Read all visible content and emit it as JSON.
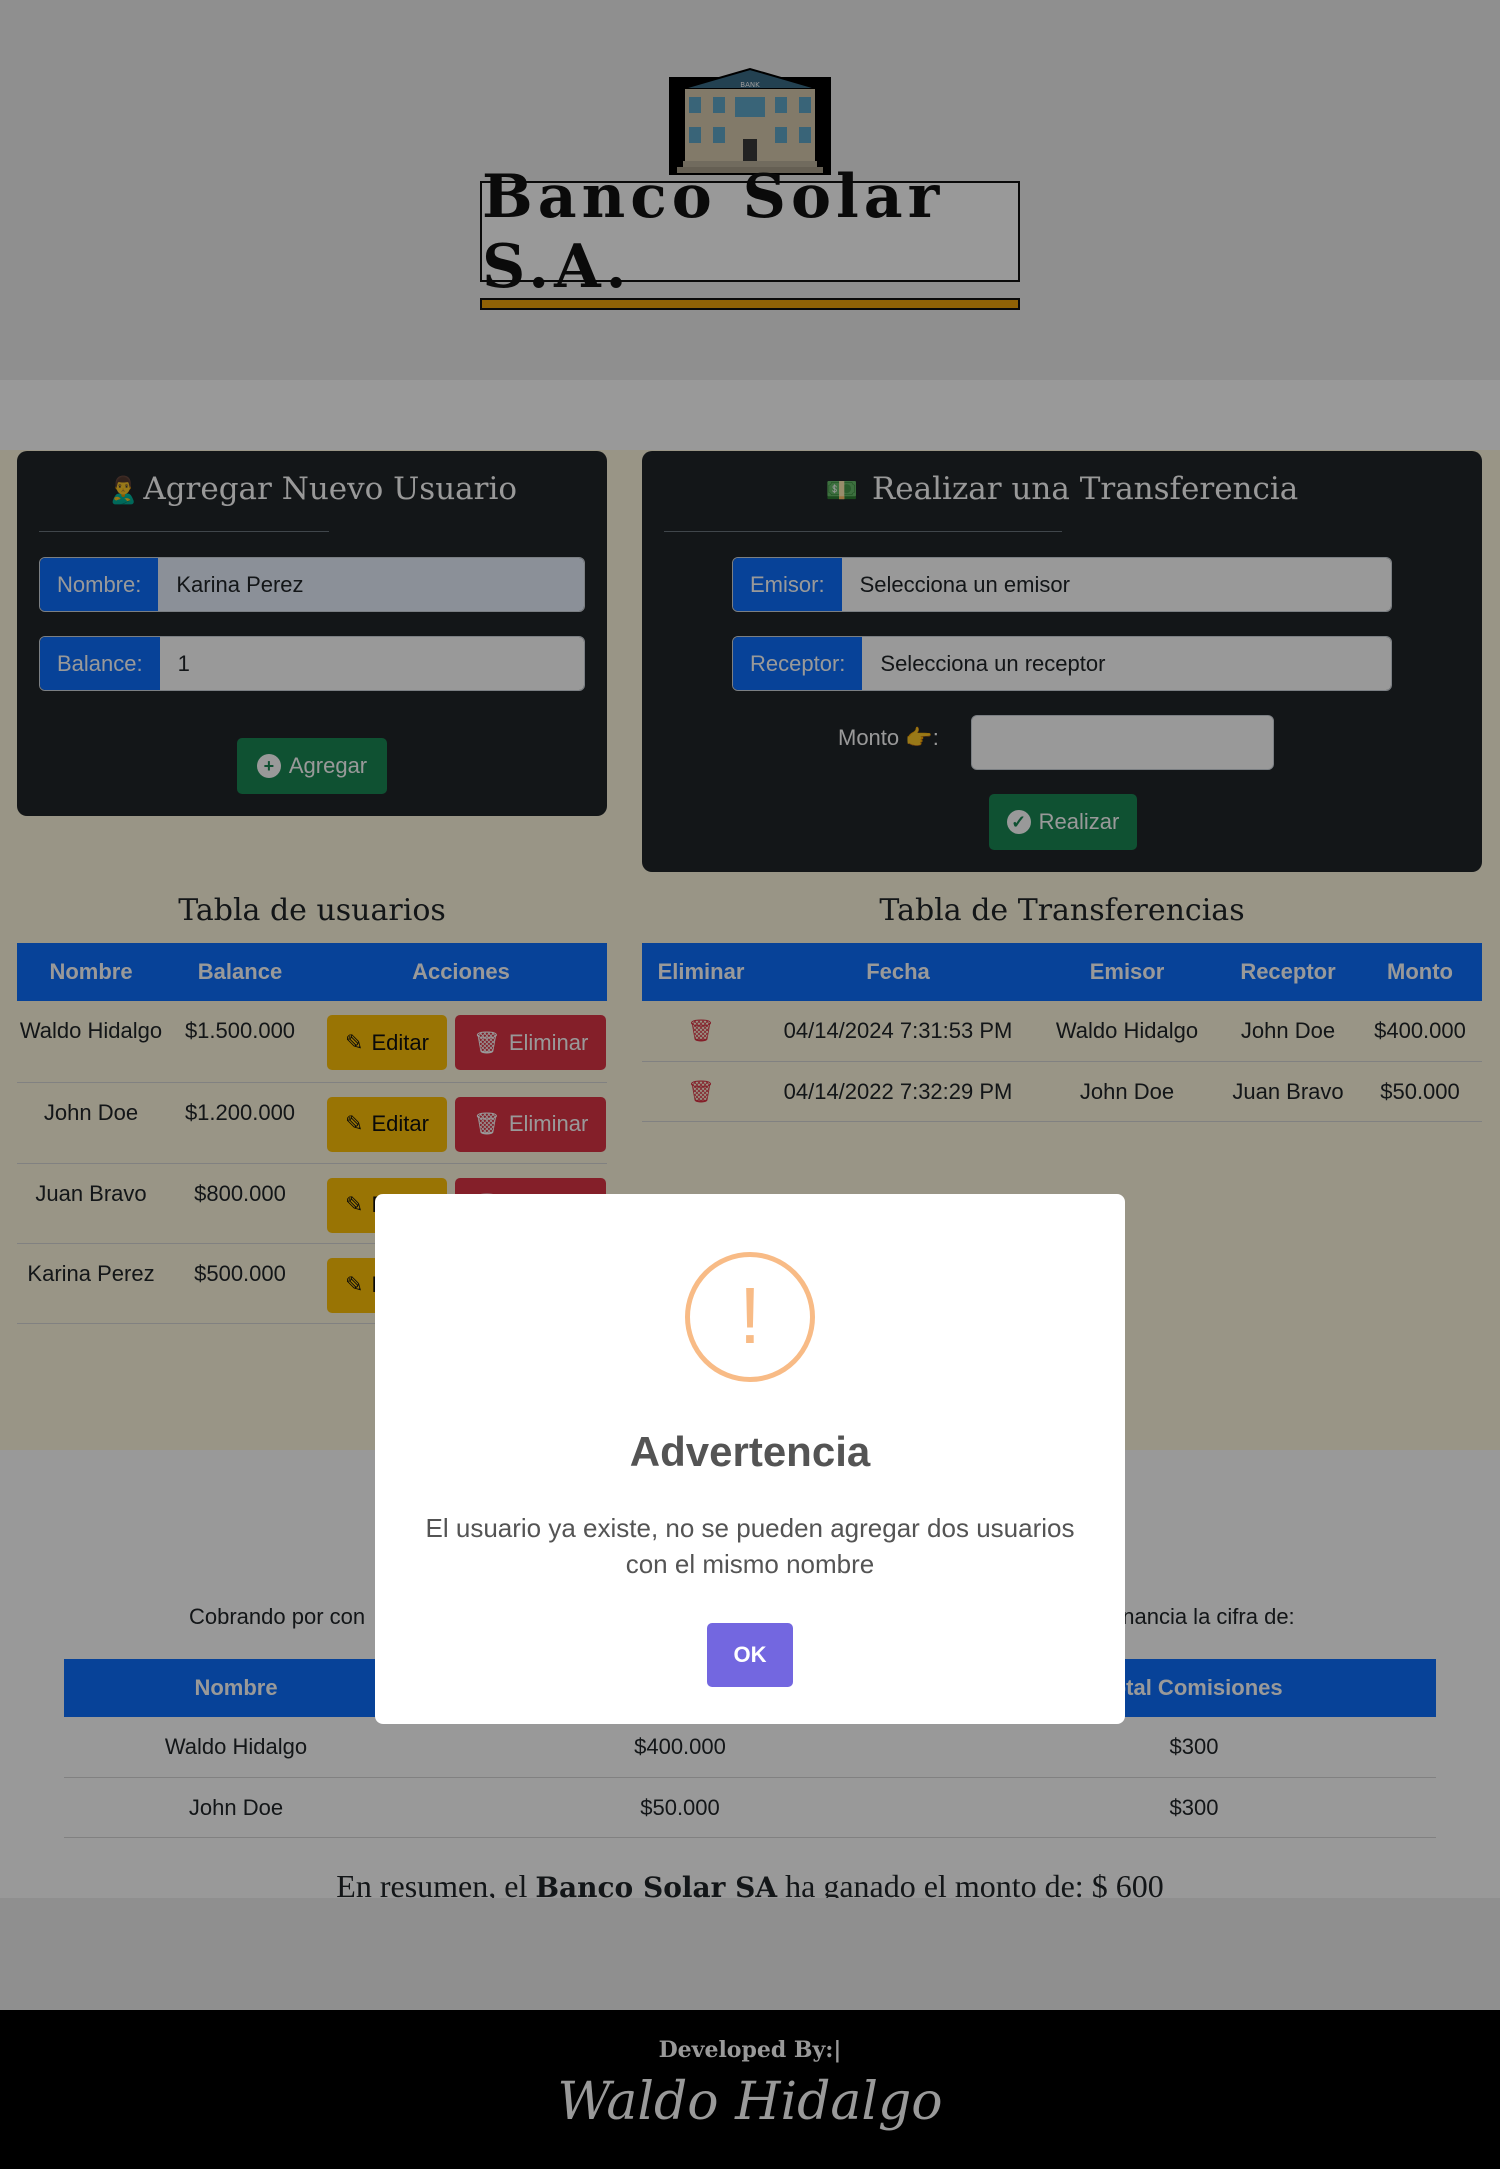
{
  "header": {
    "title": "Banco Solar S.A."
  },
  "add_user": {
    "title": "Agregar Nuevo Usuario",
    "name_label": "Nombre:",
    "name_value": "Karina Perez",
    "balance_label": "Balance:",
    "balance_value": "1",
    "add_button": "Agregar"
  },
  "transfer": {
    "title": "Realizar una Transferencia",
    "sender_label": "Emisor:",
    "sender_value": "Selecciona un emisor",
    "receiver_label": "Receptor:",
    "receiver_value": "Selecciona un receptor",
    "amount_label": "Monto",
    "amount_value": "",
    "submit_button": "Realizar"
  },
  "users_table": {
    "title": "Tabla de usuarios",
    "columns": [
      "Nombre",
      "Balance",
      "Acciones"
    ],
    "edit_label": "Editar",
    "delete_label": "Eliminar",
    "rows": [
      {
        "name": "Waldo Hidalgo",
        "balance": "$1.500.000"
      },
      {
        "name": "John Doe",
        "balance": "$1.200.000"
      },
      {
        "name": "Juan Bravo",
        "balance": "$800.000"
      },
      {
        "name": "Karina Perez",
        "balance": "$500.000"
      }
    ]
  },
  "transfers_table": {
    "title": "Tabla de Transferencias",
    "columns": [
      "Eliminar",
      "Fecha",
      "Emisor",
      "Receptor",
      "Monto"
    ],
    "rows": [
      {
        "date": "04/14/2024 7:31:53 PM",
        "sender": "Waldo Hidalgo",
        "receiver": "John Doe",
        "amount": "$400.000"
      },
      {
        "date": "04/14/2022 7:32:29 PM",
        "sender": "John Doe",
        "receiver": "Juan Bravo",
        "amount": "$50.000"
      }
    ]
  },
  "commissions": {
    "text_left": "Cobrando por con",
    "text_right": "anancia la cifra de:",
    "columns": [
      "Nombre",
      "",
      "total Comisiones"
    ],
    "rows": [
      {
        "name": "Waldo Hidalgo",
        "amount": "$400.000",
        "commission": "$300"
      },
      {
        "name": "John Doe",
        "amount": "$50.000",
        "commission": "$300"
      }
    ],
    "summary_prefix": "En resumen, el ",
    "summary_bank": "Banco Solar SA",
    "summary_suffix": " ha ganado el monto de: $ 600"
  },
  "footer": {
    "developed_by": "Developed By:|",
    "signature": "Waldo Hidalgo"
  },
  "modal": {
    "title": "Advertencia",
    "message": "El usuario ya existe, no se pueden agregar dos usuarios con el mismo nombre",
    "ok_button": "OK"
  },
  "colors": {
    "primary": "#0d6efd",
    "success": "#198754",
    "warning": "#ffc107",
    "danger": "#dc3545",
    "dark_card": "#212529",
    "modal_button": "#7367e0",
    "alert_icon": "#f8bb86"
  }
}
